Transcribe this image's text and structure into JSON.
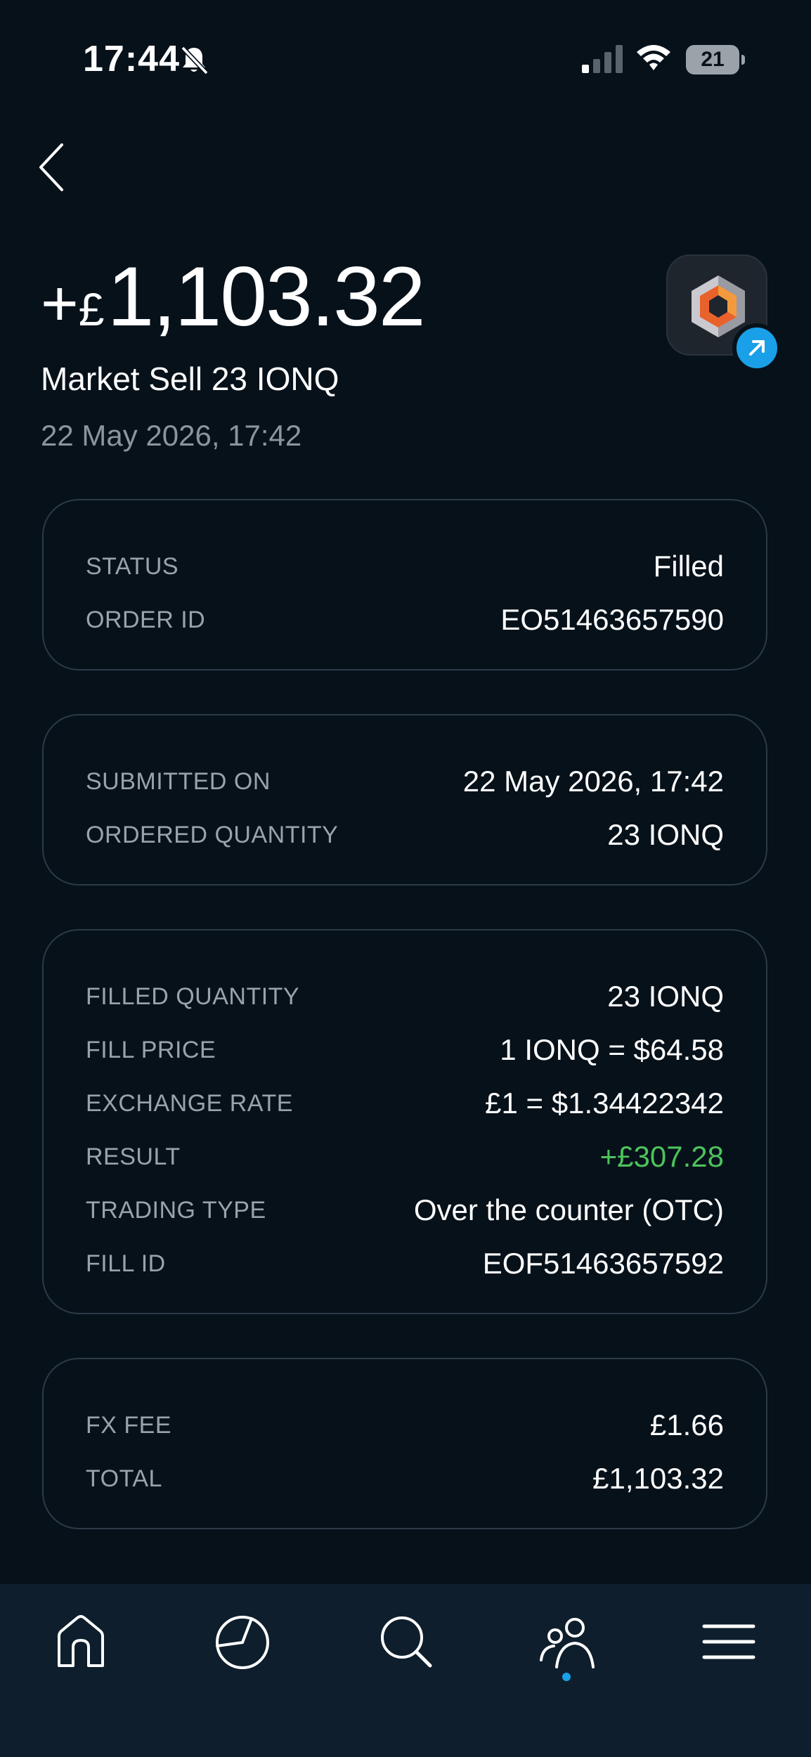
{
  "status_bar": {
    "time": "17:44",
    "battery": "21"
  },
  "header": {
    "amount_sign": "+",
    "amount_currency": "£",
    "amount_value": "1,103.32",
    "title": "Market Sell 23 IONQ",
    "date": "22 May 2026, 17:42"
  },
  "icons": {
    "back": "chevron-left-icon",
    "logo": "ionq-logo-icon",
    "badge": "arrow-up-right-icon",
    "nav": [
      "home-icon",
      "pie-chart-icon",
      "search-icon",
      "community-icon",
      "menu-icon"
    ]
  },
  "colors": {
    "background": "#07111a",
    "accent": "#1aa0e8",
    "positive": "#4cc35c",
    "label": "#9aa3ac"
  },
  "card_status": {
    "rows": [
      {
        "label": "STATUS",
        "value": "Filled"
      },
      {
        "label": "ORDER ID",
        "value": "EO51463657590"
      }
    ]
  },
  "card_submission": {
    "rows": [
      {
        "label": "SUBMITTED ON",
        "value": "22 May 2026, 17:42"
      },
      {
        "label": "ORDERED QUANTITY",
        "value": "23 IONQ"
      }
    ]
  },
  "card_fill": {
    "rows": [
      {
        "label": "FILLED QUANTITY",
        "value": "23 IONQ"
      },
      {
        "label": "FILL PRICE",
        "value": "1 IONQ = $64.58"
      },
      {
        "label": "EXCHANGE RATE",
        "value": "£1 = $1.34422342"
      },
      {
        "label": "RESULT",
        "value": "+£307.28"
      },
      {
        "label": "TRADING TYPE",
        "value": "Over the counter (OTC)"
      },
      {
        "label": "FILL ID",
        "value": "EOF51463657592"
      }
    ]
  },
  "card_fees": {
    "rows": [
      {
        "label": "FX FEE",
        "value": "£1.66"
      },
      {
        "label": "TOTAL",
        "value": "£1,103.32"
      }
    ]
  },
  "nav": {
    "active": "community"
  }
}
